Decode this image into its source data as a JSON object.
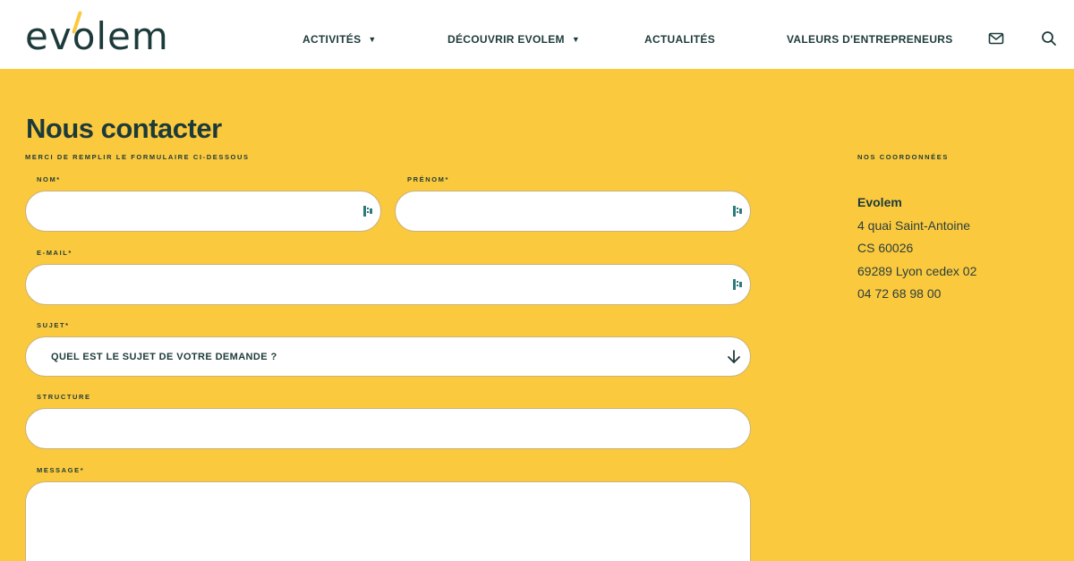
{
  "header": {
    "logo_text": "evolem",
    "nav": [
      {
        "label": "ACTIVITÉS",
        "has_dropdown": true
      },
      {
        "label": "DÉCOUVRIR EVOLEM",
        "has_dropdown": true
      },
      {
        "label": "ACTUALITÉS",
        "has_dropdown": false
      },
      {
        "label": "VALEURS D'ENTREPRENEURS",
        "has_dropdown": false
      }
    ],
    "icons": [
      "mail-icon",
      "search-icon"
    ],
    "caret": "▼"
  },
  "main": {
    "title": "Nous contacter",
    "subtitle": "MERCI DE REMPLIR LE FORMULAIRE CI-DESSOUS",
    "form": {
      "nom": {
        "label": "NOM*",
        "value": ""
      },
      "prenom": {
        "label": "PRÉNOM*",
        "value": ""
      },
      "email": {
        "label": "E-MAIL*",
        "value": ""
      },
      "sujet": {
        "label": "SUJET*",
        "selected": "QUEL EST LE SUJET DE VOTRE DEMANDE ?"
      },
      "structure": {
        "label": "STRUCTURE",
        "value": ""
      },
      "message": {
        "label": "MESSAGE*",
        "value": ""
      }
    }
  },
  "coords": {
    "heading": "NOS COORDONNÉES",
    "name": "Evolem",
    "address1": "4 quai Saint-Antoine",
    "address2": "CS 60026",
    "address3": "69289 Lyon cedex 02",
    "phone": "04 72 68 98 00"
  },
  "colors": {
    "background": "#fbc93d",
    "text": "#1d3a3a",
    "header_bg": "#ffffff",
    "accent": "#fbc93d"
  }
}
